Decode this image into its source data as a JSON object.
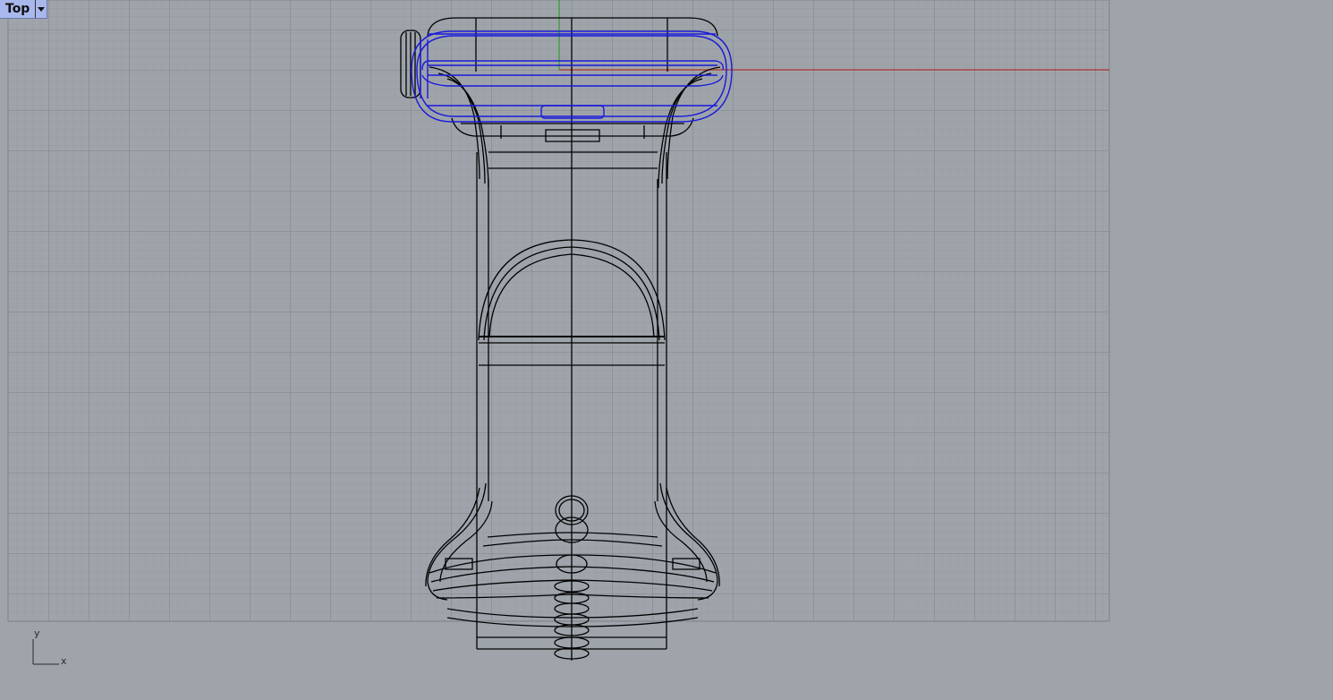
{
  "viewport": {
    "title": "Top",
    "menu_icon": "chevron-down-icon"
  },
  "axis_triad": {
    "x_label": "x",
    "y_label": "y"
  },
  "colors": {
    "background": "#9fa4ab",
    "grid_minor": "#959aa1",
    "grid_major": "#7d8289",
    "x_axis": "#b03030",
    "y_axis": "#2f9a2f",
    "wire": "#000000",
    "selected": "#1a1ad9",
    "tab": "#a9b8ec"
  }
}
